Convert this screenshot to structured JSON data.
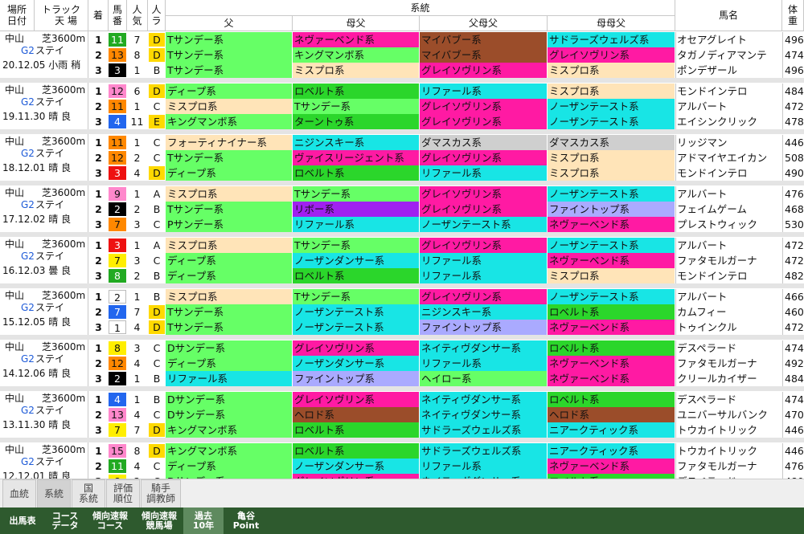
{
  "header": {
    "place_date": "場所\n日付",
    "track": "トラック\n　天 場",
    "pos": "着",
    "num": "馬\n番",
    "pop": "人\n気",
    "pace": "人\nラ",
    "lineage": "系統",
    "sire": "父",
    "dam_sire": "母父",
    "sire_dam_sire": "父母父",
    "dam_dam_sire": "母母父",
    "horse": "馬名",
    "weight": "体\n重"
  },
  "colors": {
    "Tサンデー系": "#66ff66",
    "Dサンデー系": "#66ff66",
    "Pサンデー系": "#66ff66",
    "ディープ系": "#66ff66",
    "ネヴァーベンド系": "#ff1aa3",
    "キングマンボ系": "#66ff66",
    "マイバブー系": "#9b4d2a",
    "サドラーズウェルズ系": "#18e5e5",
    "グレイソヴリン系": "#ff1aa3",
    "ミスプロ系": "#ffe4b8",
    "ロベルト系": "#2bd62b",
    "リファール系": "#18e5e5",
    "ノーザンテースト系": "#18e5e5",
    "ターントゥ系": "#2bd62b",
    "フォーティナイナー系": "#ffe4b8",
    "ニジンスキー系": "#18e5e5",
    "ダマスカス系": "#cfcfcf",
    "ヴァイスリージェント系": "#ff1aa3",
    "リボー系": "#a020f0",
    "ファイントップ系": "#aaaaff",
    "ノーザンダンサー系": "#18e5e5",
    "ネイティヴダンサー系": "#18e5e5",
    "ヘイロー系": "#66ff66",
    "ヘロド系": "#9b4d2a",
    "ニアークティック系": "#18e5e5"
  },
  "num_colors": {
    "1": "#ffffff",
    "2": "#000000",
    "3": "#ee1111",
    "4": "#2266ee",
    "5": "#ffee00",
    "6": "#22aa22",
    "7": "#ff8800",
    "8": "#ff88cc"
  },
  "pace_colors": {
    "D": "#ffd900",
    "E": "#ffd900"
  },
  "races": [
    {
      "place": "中山",
      "dist": "芝3600m",
      "grade": "G2",
      "name": "ステイ",
      "date": "20.12.05 小雨 稍",
      "rows": [
        {
          "pos": "1",
          "num": "11",
          "frame": 6,
          "pop": "7",
          "ps": "D",
          "f": "Tサンデー系",
          "mf": "ネヴァーベンド系",
          "ff": "マイバブー系",
          "mmf": "サドラーズウェルズ系",
          "horse": "オセアグレイト",
          "wt": "496"
        },
        {
          "pos": "2",
          "num": "13",
          "frame": 7,
          "pop": "8",
          "ps": "D",
          "f": "Tサンデー系",
          "mf": "キングマンボ系",
          "ff": "マイバブー系",
          "mmf": "グレイソヴリン系",
          "horse": "タガノディアマンテ",
          "wt": "474"
        },
        {
          "pos": "3",
          "num": "3",
          "frame": 2,
          "pop": "1",
          "ps": "B",
          "f": "Tサンデー系",
          "mf": "ミスプロ系",
          "ff": "グレイソヴリン系",
          "mmf": "ミスプロ系",
          "horse": "ポンデザール",
          "wt": "496"
        }
      ]
    },
    {
      "place": "中山",
      "dist": "芝3600m",
      "grade": "G2",
      "name": "ステイ",
      "date": "19.11.30 晴 良",
      "rows": [
        {
          "pos": "1",
          "num": "12",
          "frame": 8,
          "pop": "6",
          "ps": "D",
          "f": "ディープ系",
          "mf": "ロベルト系",
          "ff": "リファール系",
          "mmf": "ミスプロ系",
          "horse": "モンドインテロ",
          "wt": "484"
        },
        {
          "pos": "2",
          "num": "11",
          "frame": 7,
          "pop": "1",
          "ps": "C",
          "f": "ミスプロ系",
          "mf": "Tサンデー系",
          "ff": "グレイソヴリン系",
          "mmf": "ノーザンテースト系",
          "horse": "アルバート",
          "wt": "472"
        },
        {
          "pos": "3",
          "num": "4",
          "frame": 4,
          "pop": "11",
          "ps": "E",
          "f": "キングマンボ系",
          "mf": "ターントゥ系",
          "ff": "グレイソヴリン系",
          "mmf": "ノーザンテースト系",
          "horse": "エイシンクリック",
          "wt": "478"
        }
      ]
    },
    {
      "place": "中山",
      "dist": "芝3600m",
      "grade": "G2",
      "name": "ステイ",
      "date": "18.12.01 晴 良",
      "rows": [
        {
          "pos": "1",
          "num": "11",
          "frame": 7,
          "pop": "1",
          "ps": "C",
          "f": "フォーティナイナー系",
          "mf": "ニジンスキー系",
          "ff": "ダマスカス系",
          "mmf": "ダマスカス系",
          "horse": "リッジマン",
          "wt": "446"
        },
        {
          "pos": "2",
          "num": "12",
          "frame": 7,
          "pop": "2",
          "ps": "C",
          "f": "Tサンデー系",
          "mf": "ヴァイスリージェント系",
          "ff": "グレイソヴリン系",
          "mmf": "ミスプロ系",
          "horse": "アドマイヤエイカン",
          "wt": "508"
        },
        {
          "pos": "3",
          "num": "3",
          "frame": 3,
          "pop": "4",
          "ps": "D",
          "f": "ディープ系",
          "mf": "ロベルト系",
          "ff": "リファール系",
          "mmf": "ミスプロ系",
          "horse": "モンドインテロ",
          "wt": "490"
        }
      ]
    },
    {
      "place": "中山",
      "dist": "芝3600m",
      "grade": "G2",
      "name": "ステイ",
      "date": "17.12.02 晴 良",
      "rows": [
        {
          "pos": "1",
          "num": "9",
          "frame": 8,
          "pop": "1",
          "ps": "A",
          "f": "ミスプロ系",
          "mf": "Tサンデー系",
          "ff": "グレイソヴリン系",
          "mmf": "ノーザンテースト系",
          "horse": "アルバート",
          "wt": "476"
        },
        {
          "pos": "2",
          "num": "2",
          "frame": 2,
          "pop": "2",
          "ps": "B",
          "f": "Tサンデー系",
          "mf": "リボー系",
          "ff": "グレイソヴリン系",
          "mmf": "ファイントップ系",
          "horse": "フェイムゲーム",
          "wt": "468"
        },
        {
          "pos": "3",
          "num": "7",
          "frame": 7,
          "pop": "3",
          "ps": "C",
          "f": "Pサンデー系",
          "mf": "リファール系",
          "ff": "ノーザンテースト系",
          "mmf": "ネヴァーベンド系",
          "horse": "プレストウィック",
          "wt": "530"
        }
      ]
    },
    {
      "place": "中山",
      "dist": "芝3600m",
      "grade": "G2",
      "name": "ステイ",
      "date": "16.12.03 曇 良",
      "rows": [
        {
          "pos": "1",
          "num": "3",
          "frame": 3,
          "pop": "1",
          "ps": "A",
          "f": "ミスプロ系",
          "mf": "Tサンデー系",
          "ff": "グレイソヴリン系",
          "mmf": "ノーザンテースト系",
          "horse": "アルバート",
          "wt": "472"
        },
        {
          "pos": "2",
          "num": "7",
          "frame": 5,
          "pop": "3",
          "ps": "C",
          "f": "ディープ系",
          "mf": "ノーザンダンサー系",
          "ff": "リファール系",
          "mmf": "ネヴァーベンド系",
          "horse": "ファタモルガーナ",
          "wt": "472"
        },
        {
          "pos": "3",
          "num": "8",
          "frame": 6,
          "pop": "2",
          "ps": "B",
          "f": "ディープ系",
          "mf": "ロベルト系",
          "ff": "リファール系",
          "mmf": "ミスプロ系",
          "horse": "モンドインテロ",
          "wt": "482"
        }
      ]
    },
    {
      "place": "中山",
      "dist": "芝3600m",
      "grade": "G2",
      "name": "ステイ",
      "date": "15.12.05 晴 良",
      "rows": [
        {
          "pos": "1",
          "num": "2",
          "frame": 1,
          "pop": "1",
          "ps": "B",
          "f": "ミスプロ系",
          "mf": "Tサンデー系",
          "ff": "グレイソヴリン系",
          "mmf": "ノーザンテースト系",
          "horse": "アルバート",
          "wt": "466"
        },
        {
          "pos": "2",
          "num": "7",
          "frame": 4,
          "pop": "7",
          "ps": "D",
          "f": "Tサンデー系",
          "mf": "ノーザンテースト系",
          "ff": "ニジンスキー系",
          "mmf": "ロベルト系",
          "horse": "カムフィー",
          "wt": "460"
        },
        {
          "pos": "3",
          "num": "1",
          "frame": 1,
          "pop": "4",
          "ps": "D",
          "f": "Tサンデー系",
          "mf": "ノーザンテースト系",
          "ff": "ファイントップ系",
          "mmf": "ネヴァーベンド系",
          "horse": "トゥインクル",
          "wt": "472"
        }
      ]
    },
    {
      "place": "中山",
      "dist": "芝3600m",
      "grade": "G2",
      "name": "ステイ",
      "date": "14.12.06 晴 良",
      "rows": [
        {
          "pos": "1",
          "num": "8",
          "frame": 5,
          "pop": "3",
          "ps": "C",
          "f": "Dサンデー系",
          "mf": "グレイソヴリン系",
          "ff": "ネイティヴダンサー系",
          "mmf": "ロベルト系",
          "horse": "デスペラード",
          "wt": "474"
        },
        {
          "pos": "2",
          "num": "12",
          "frame": 7,
          "pop": "4",
          "ps": "C",
          "f": "ディープ系",
          "mf": "ノーザンダンサー系",
          "ff": "リファール系",
          "mmf": "ネヴァーベンド系",
          "horse": "ファタモルガーナ",
          "wt": "492"
        },
        {
          "pos": "3",
          "num": "2",
          "frame": 2,
          "pop": "1",
          "ps": "B",
          "f": "リファール系",
          "mf": "ファイントップ系",
          "ff": "ヘイロー系",
          "mmf": "ネヴァーベンド系",
          "horse": "クリールカイザー",
          "wt": "484"
        }
      ]
    },
    {
      "place": "中山",
      "dist": "芝3600m",
      "grade": "G2",
      "name": "ステイ",
      "date": "13.11.30 晴 良",
      "rows": [
        {
          "pos": "1",
          "num": "4",
          "frame": 4,
          "pop": "1",
          "ps": "B",
          "f": "Dサンデー系",
          "mf": "グレイソヴリン系",
          "ff": "ネイティヴダンサー系",
          "mmf": "ロベルト系",
          "horse": "デスペラード",
          "wt": "474"
        },
        {
          "pos": "2",
          "num": "13",
          "frame": 8,
          "pop": "4",
          "ps": "C",
          "f": "Dサンデー系",
          "mf": "ヘロド系",
          "ff": "ネイティヴダンサー系",
          "mmf": "ヘロド系",
          "horse": "ユニバーサルバンク",
          "wt": "470"
        },
        {
          "pos": "3",
          "num": "7",
          "frame": 5,
          "pop": "7",
          "ps": "D",
          "f": "キングマンボ系",
          "mf": "ロベルト系",
          "ff": "サドラーズウェルズ系",
          "mmf": "ニアークティック系",
          "horse": "トウカイトリック",
          "wt": "446"
        }
      ]
    },
    {
      "place": "中山",
      "dist": "芝3600m",
      "grade": "G2",
      "name": "ステイ",
      "date": "12.12.01 晴 良",
      "rows": [
        {
          "pos": "1",
          "num": "15",
          "frame": 8,
          "pop": "8",
          "ps": "D",
          "f": "キングマンボ系",
          "mf": "ロベルト系",
          "ff": "サドラーズウェルズ系",
          "mmf": "ニアークティック系",
          "horse": "トウカイトリック",
          "wt": "446"
        },
        {
          "pos": "2",
          "num": "11",
          "frame": 6,
          "pop": "4",
          "ps": "C",
          "f": "ディープ系",
          "mf": "ノーザンダンサー系",
          "ff": "リファール系",
          "mmf": "ネヴァーベンド系",
          "horse": "ファタモルガーナ",
          "wt": "476"
        },
        {
          "pos": "3",
          "num": "8",
          "frame": 5,
          "pop": "2",
          "ps": "C",
          "f": "Dサンデー系",
          "mf": "グレイソヴリン系",
          "ff": "ネイティヴダンサー系",
          "mmf": "ロベルト系",
          "horse": "デスペラード",
          "wt": "480"
        }
      ]
    }
  ],
  "tabs": [
    {
      "label": "血統",
      "active": false
    },
    {
      "label": "系統",
      "active": true
    },
    {
      "label": "国\n系統",
      "active": false
    },
    {
      "label": "評価\n順位",
      "active": false
    },
    {
      "label": "騎手\n調教師",
      "active": false
    }
  ],
  "footer": [
    {
      "label": "出馬表",
      "active": false
    },
    {
      "label": "コース\nデータ",
      "active": false
    },
    {
      "label": "傾向速報\nコース",
      "active": false
    },
    {
      "label": "傾向速報\n競馬場",
      "active": false
    },
    {
      "label": "過去\n10年",
      "active": true
    },
    {
      "label": "亀谷\nPoint",
      "active": false
    }
  ]
}
